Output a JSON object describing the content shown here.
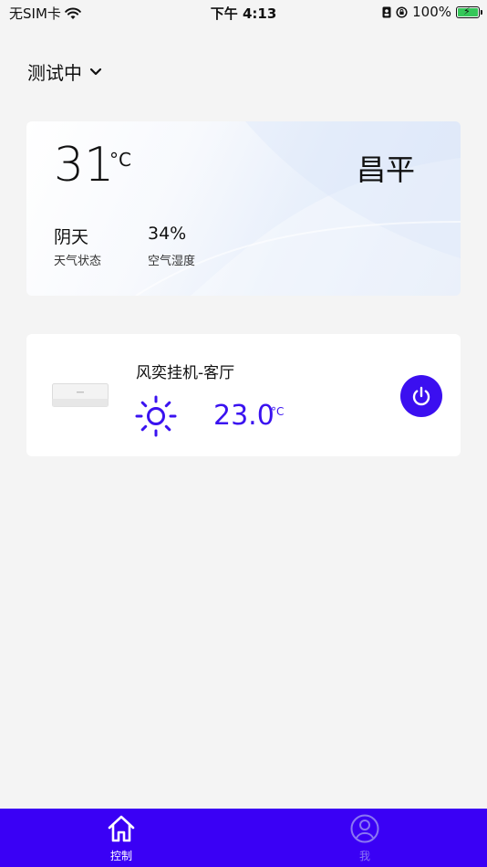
{
  "status_bar": {
    "carrier": "无SIM卡",
    "time": "下午 4:13",
    "battery": "100%"
  },
  "header": {
    "home_name": "测试中"
  },
  "weather": {
    "temperature": "31",
    "unit": "°C",
    "city": "昌平",
    "condition_value": "阴天",
    "condition_label": "天气状态",
    "humidity_value": "34%",
    "humidity_label": "空气湿度"
  },
  "device": {
    "name": "风奕挂机-客厅",
    "mode_icon": "sun-icon",
    "set_temperature": "23.0",
    "unit": "°C",
    "power_icon": "power-icon"
  },
  "tabbar": {
    "tabs": [
      {
        "label": "控制",
        "icon": "home-icon",
        "active": true
      },
      {
        "label": "我",
        "icon": "user-icon",
        "active": false
      }
    ]
  },
  "colors": {
    "accent": "#3a00f5",
    "background": "#f4f4f4",
    "battery_fill": "#35c759"
  }
}
